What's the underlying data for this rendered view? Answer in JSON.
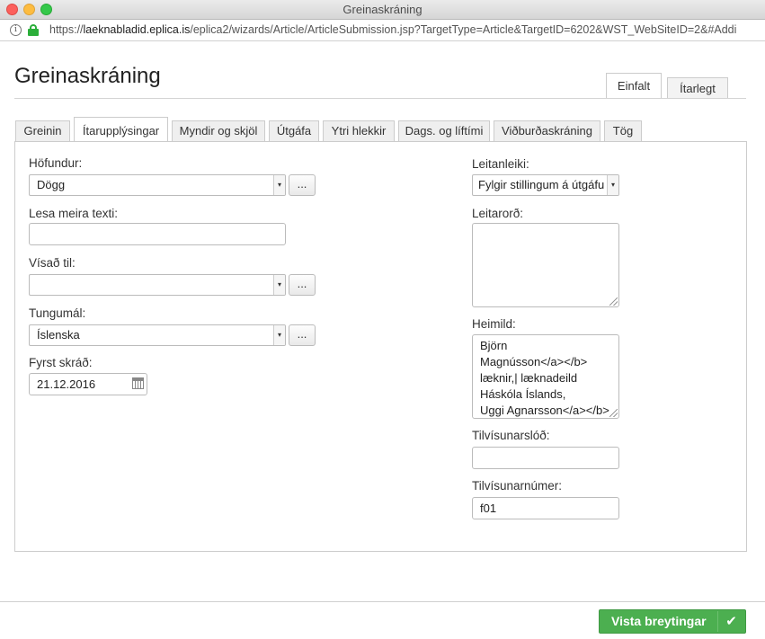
{
  "window": {
    "title": "Greinaskráning"
  },
  "address": {
    "scheme": "https://",
    "host": "laeknabladid.eplica.is",
    "path": "/eplica2/wizards/Article/ArticleSubmission.jsp?TargetType=Article&TargetID=6202&WST_WebSiteID=2&#Addi"
  },
  "page": {
    "title": "Greinaskráning"
  },
  "modes": {
    "simple": "Einfalt",
    "advanced": "Ítarlegt"
  },
  "tabs": [
    "Greinin",
    "Ítarupplýsingar",
    "Myndir og skjöl",
    "Útgáfa",
    "Ytri hlekkir",
    "Dags. og líftími",
    "Viðburðaskráning",
    "Tög"
  ],
  "form": {
    "author": {
      "label": "Höfundur:",
      "value": "Dögg"
    },
    "read_more": {
      "label": "Lesa meira texti:",
      "value": ""
    },
    "referred_to": {
      "label": "Vísað til:",
      "value": ""
    },
    "language": {
      "label": "Tungumál:",
      "value": "Íslenska"
    },
    "first_registered": {
      "label": "Fyrst skráð:",
      "value": "21.12.2016"
    },
    "searchability": {
      "label": "Leitanleiki:",
      "value": "Fylgir stillingum á útgáfu"
    },
    "keywords": {
      "label": "Leitarorð:",
      "value": ""
    },
    "source": {
      "label": "Heimild:",
      "lines": [
        "Björn",
        "Magnússon</a></b>",
        "læknir,| læknadeild",
        "Háskóla Íslands,",
        "Uggi Agnarsson</a></b>"
      ]
    },
    "reference_url": {
      "label": "Tilvísunarslóð:",
      "value": ""
    },
    "reference_number": {
      "label": "Tilvísunarnúmer:",
      "value": "f01"
    },
    "dots_label": "..."
  },
  "footer": {
    "save_label": "Vista breytingar"
  },
  "colors": {
    "save_button": "#4caf50"
  }
}
